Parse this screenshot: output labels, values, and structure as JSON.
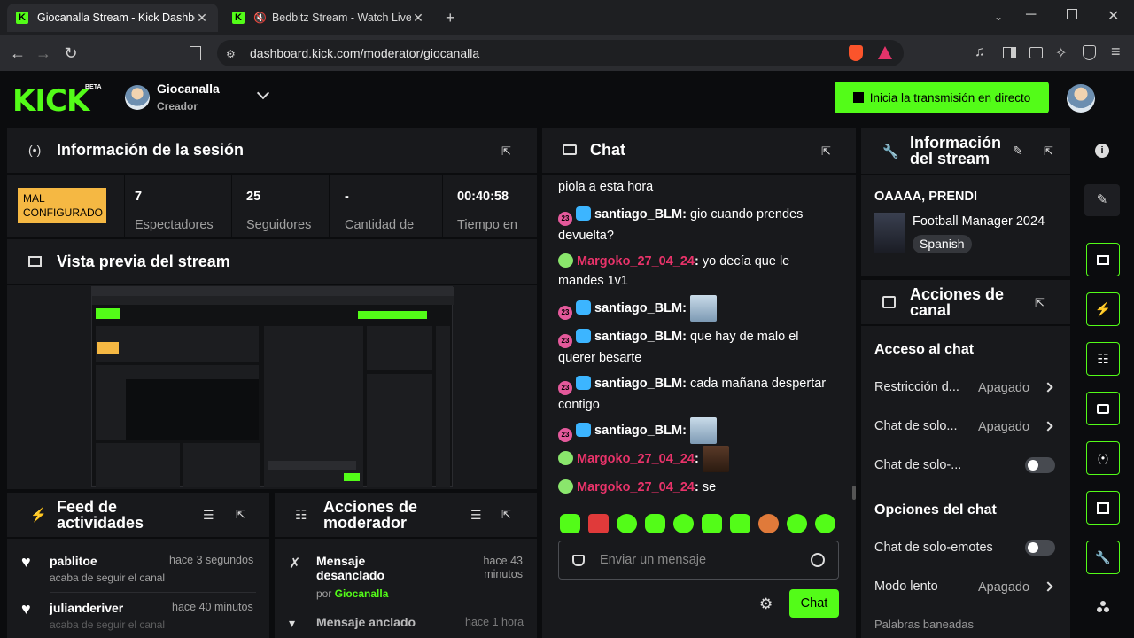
{
  "browser": {
    "tabs": [
      {
        "title": "Giocanalla Stream - Kick Dashboard"
      },
      {
        "title": "Bedbitz Stream - Watch Live on Kick"
      }
    ],
    "url": "dashboard.kick.com/moderator/giocanalla"
  },
  "header": {
    "logo": "KICK",
    "beta": "BETA",
    "user_name": "Giocanalla",
    "user_role": "Creador",
    "go_live_label": "Inicia la transmisión en directo"
  },
  "session": {
    "title": "Información de la sesión",
    "status_badge": "MAL CONFIGURADO",
    "stats": [
      {
        "value": "7",
        "label": "Espectadores"
      },
      {
        "value": "25",
        "label": "Seguidores"
      },
      {
        "value": "-",
        "label": "Cantidad de"
      },
      {
        "value": "00:40:58",
        "label": "Tiempo en"
      }
    ]
  },
  "preview": {
    "title": "Vista previa del stream"
  },
  "activity": {
    "title": "Feed de actividades",
    "items": [
      {
        "user": "pablitoe",
        "time": "hace 3 segundos",
        "text": "acaba de seguir el canal"
      },
      {
        "user": "julianderiver",
        "time": "hace 40 minutos",
        "text": "acaba de seguir el canal"
      }
    ]
  },
  "mod_actions": {
    "title": "Acciones de moderador",
    "items": [
      {
        "action": "Mensaje desanclado",
        "by": "por",
        "user": "Giocanalla",
        "time": "hace 43 minutos"
      },
      {
        "action": "Mensaje anclado",
        "time": "hace 1 hora"
      }
    ]
  },
  "chat": {
    "title": "Chat",
    "messages": [
      {
        "text": "piola a esta hora"
      },
      {
        "user": "santiago_BLM",
        "sep": ":",
        "text": "gio cuando prendes devuelta?"
      },
      {
        "user": "Margoko_27_04_24",
        "sep": ":",
        "text": "yo decía que le mandes 1v1"
      },
      {
        "user": "santiago_BLM",
        "sep": ":"
      },
      {
        "user": "santiago_BLM",
        "sep": ":",
        "text": "que hay de malo el querer besarte"
      },
      {
        "user": "santiago_BLM",
        "sep": ":",
        "text": "cada mañana despertar contigo"
      },
      {
        "user": "santiago_BLM",
        "sep": ":"
      },
      {
        "user": "Margoko_27_04_24",
        "sep": ":"
      },
      {
        "user": "Margoko_27_04_24",
        "sep": ":",
        "text": "se"
      }
    ],
    "sub_badge": "23",
    "input_placeholder": "Enviar un mensaje",
    "send_label": "Chat"
  },
  "stream_info": {
    "title": "Información del stream",
    "stream_title": "OAAAA, PRENDI",
    "category": "Football Manager 2024",
    "language": "Spanish"
  },
  "channel_actions": {
    "title": "Acciones de canal",
    "chat_access_heading": "Acceso al chat",
    "rows1": [
      {
        "label": "Restricción d...",
        "value": "Apagado"
      },
      {
        "label": "Chat de solo...",
        "value": "Apagado"
      },
      {
        "label": "Chat de solo-..."
      }
    ],
    "chat_options_heading": "Opciones del chat",
    "rows2": [
      {
        "label": "Chat de solo-emotes"
      },
      {
        "label": "Modo lento",
        "value": "Apagado"
      },
      {
        "label": "Palabras baneadas"
      }
    ]
  },
  "colors": {
    "accent": "#53fc18",
    "warning": "#f5b843",
    "mod_name": "#e9336a"
  }
}
